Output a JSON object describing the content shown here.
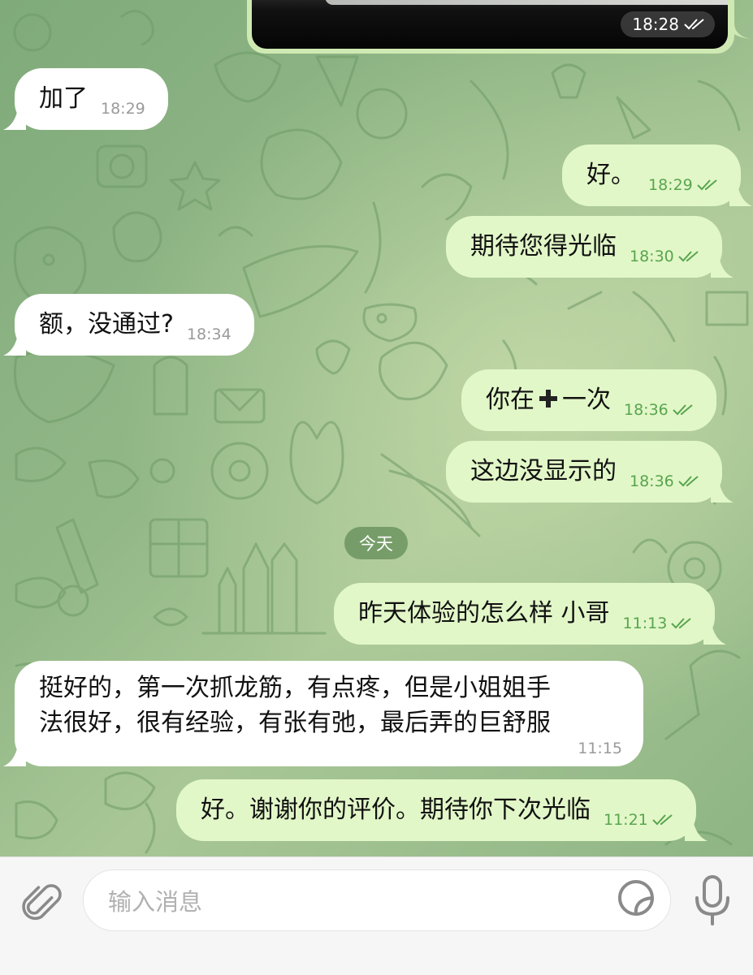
{
  "chat": {
    "photo_time": "18:28",
    "messages": [
      {
        "direction": "in",
        "text": "加了",
        "time": "18:29"
      },
      {
        "direction": "out",
        "text": "好。",
        "time": "18:29"
      },
      {
        "direction": "out",
        "text": "期待您得光临",
        "time": "18:30"
      },
      {
        "direction": "in",
        "text": "额，没通过?",
        "time": "18:34"
      },
      {
        "direction": "out",
        "text_before": "你在",
        "text_after": "一次",
        "time": "18:36"
      },
      {
        "direction": "out",
        "text": "这边没显示的",
        "time": "18:36"
      },
      {
        "direction": "out",
        "text": "昨天体验的怎么样 小哥",
        "time": "11:13"
      },
      {
        "direction": "in",
        "line1": "挺好的，第一次抓龙筋，有点疼，但是小姐姐手",
        "line2": "法很好，很有经验，有张有弛，最后弄的巨舒服",
        "time": "11:15"
      },
      {
        "direction": "out",
        "text": "好。谢谢你的评价。期待你下次光临",
        "time": "11:21"
      }
    ],
    "date_separator": "今天"
  },
  "composer": {
    "placeholder": "输入消息",
    "attach_icon": "paperclip-icon",
    "sticker_icon": "sticker-icon",
    "mic_icon": "microphone-icon"
  },
  "colors": {
    "incoming_bubble": "#ffffff",
    "outgoing_bubble": "#e2f7c8",
    "outgoing_meta": "#58a54f",
    "wallpaper": "#93b888"
  }
}
